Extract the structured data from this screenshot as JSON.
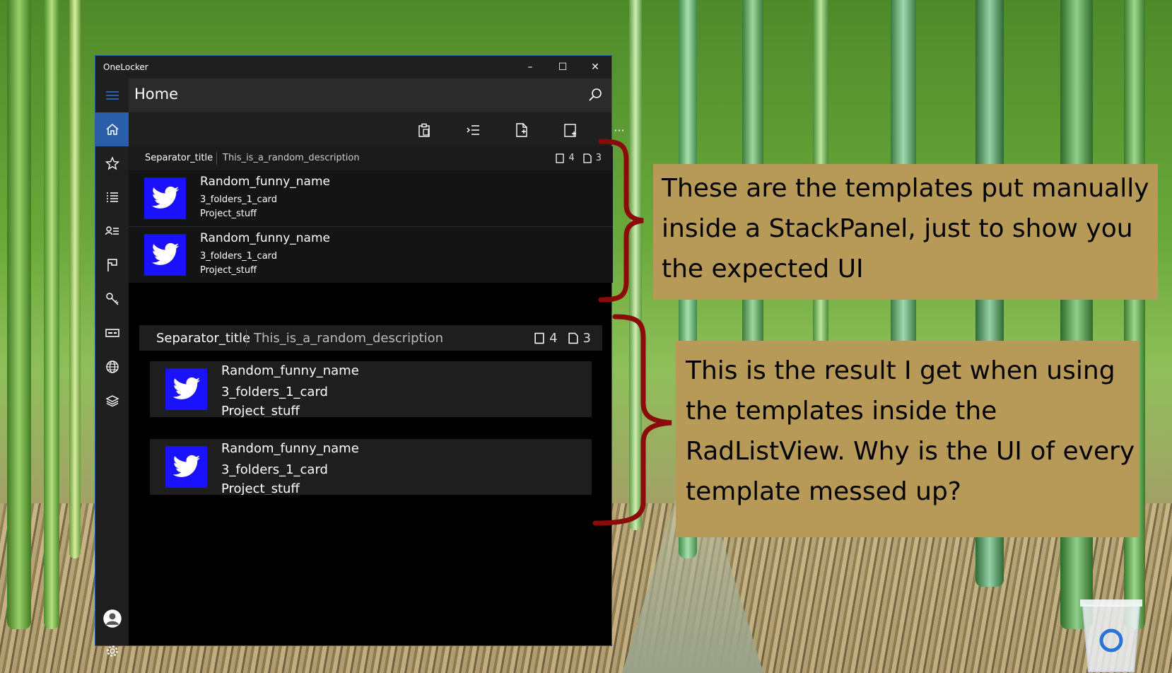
{
  "window": {
    "app_title": "OneLocker",
    "page_title": "Home",
    "controls": {
      "minimize": "–",
      "maximize": "☐",
      "close": "✕"
    }
  },
  "toolbar": {
    "more_label": "···"
  },
  "expected_list": {
    "separator": {
      "title": "Separator_title",
      "description": "This_is_a_random_description",
      "folder_count": "4",
      "card_count": "3"
    },
    "items": [
      {
        "name": "Random_funny_name",
        "subtitle": "3_folders_1_card",
        "category": "Project_stuff"
      },
      {
        "name": "Random_funny_name",
        "subtitle": "3_folders_1_card",
        "category": "Project_stuff"
      }
    ]
  },
  "radlistview": {
    "separator": {
      "title": "Separator_title",
      "description": "This_is_a_random_description",
      "folder_count": "4",
      "card_count": "3"
    },
    "items": [
      {
        "name": "Random_funny_name",
        "subtitle": "3_folders_1_card",
        "category": "Project_stuff"
      },
      {
        "name": "Random_funny_name",
        "subtitle": "3_folders_1_card",
        "category": "Project_stuff"
      }
    ]
  },
  "annotations": {
    "note1": "These are the templates put manually inside a StackPanel, just to show you the expected UI",
    "note2": "This is the result I get when using the templates inside the RadListView. Why is the UI of every template messed up?"
  },
  "colors": {
    "accent": "#2b5ea8",
    "avatar_bg": "#1a12ff",
    "note_bg": "#b79a57",
    "brace": "#8b0b0b"
  }
}
